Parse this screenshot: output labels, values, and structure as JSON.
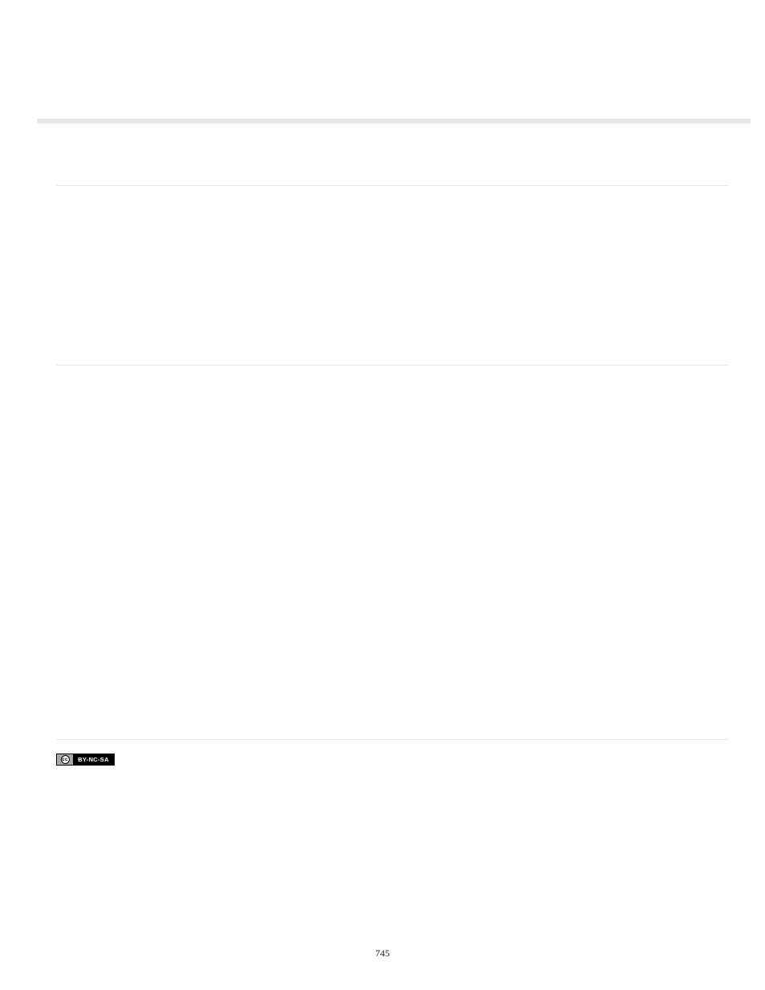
{
  "license_badge": {
    "left_label": "cc",
    "right_label": "BY-NC-SA"
  },
  "page_number": "745"
}
